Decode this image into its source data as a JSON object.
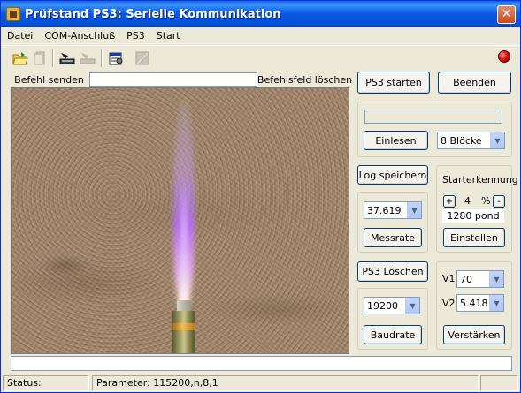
{
  "window": {
    "title": "Prüfstand PS3: Serielle Kommunikation"
  },
  "menu": {
    "items": [
      "Datei",
      "COM-Anschluß",
      "PS3",
      "Start"
    ]
  },
  "toolbar": {
    "icons": [
      "open-icon",
      "file-disabled-icon",
      "scanner-icon",
      "scanner-disabled-icon",
      "properties-icon",
      "stop-disabled-icon"
    ],
    "status_led_color": "#e01010"
  },
  "command": {
    "send_label": "Befehl senden",
    "input_value": "",
    "clear_label": "Befehlsfeld löschen"
  },
  "controls": {
    "ps3_start": "PS3 starten",
    "quit": "Beenden",
    "read_in": "Einlesen",
    "blocks_value": "8 Blöcke",
    "log_save": "Log speichern",
    "rate_value": "37.619",
    "rate_button": "Messrate",
    "starter_title": "Starterkennung",
    "plus": "+",
    "percent_value": "4",
    "percent_unit": "%",
    "minus": "-",
    "pond_value": "1280 pond",
    "set_button": "Einstellen",
    "ps3_clear": "PS3 Löschen",
    "baud_value": "19200",
    "baud_button": "Baudrate",
    "v1_label": "V1",
    "v1_value": "70",
    "v2_label": "V2",
    "v2_value": "5.418",
    "amplify_button": "Verstärken"
  },
  "status": {
    "label": "Status:",
    "params": "Parameter: 115200,n,8,1"
  }
}
